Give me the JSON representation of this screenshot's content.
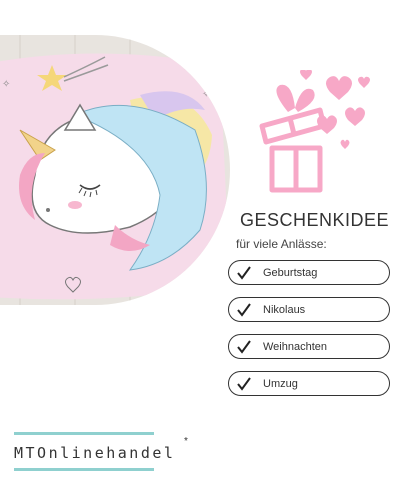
{
  "headline": "GESCHENKIDEE",
  "subline": "für viele Anlässe:",
  "occasions": [
    {
      "label": "Geburtstag"
    },
    {
      "label": "Nikolaus"
    },
    {
      "label": "Weihnachten"
    },
    {
      "label": "Umzug"
    }
  ],
  "brand": {
    "name": "MTOnlinehandel",
    "mark": "*"
  },
  "colors": {
    "accent_pink": "#f7a8c7",
    "brand_teal": "#8fd0cf",
    "text": "#333333",
    "photo_pink": "#f6dbe9"
  }
}
